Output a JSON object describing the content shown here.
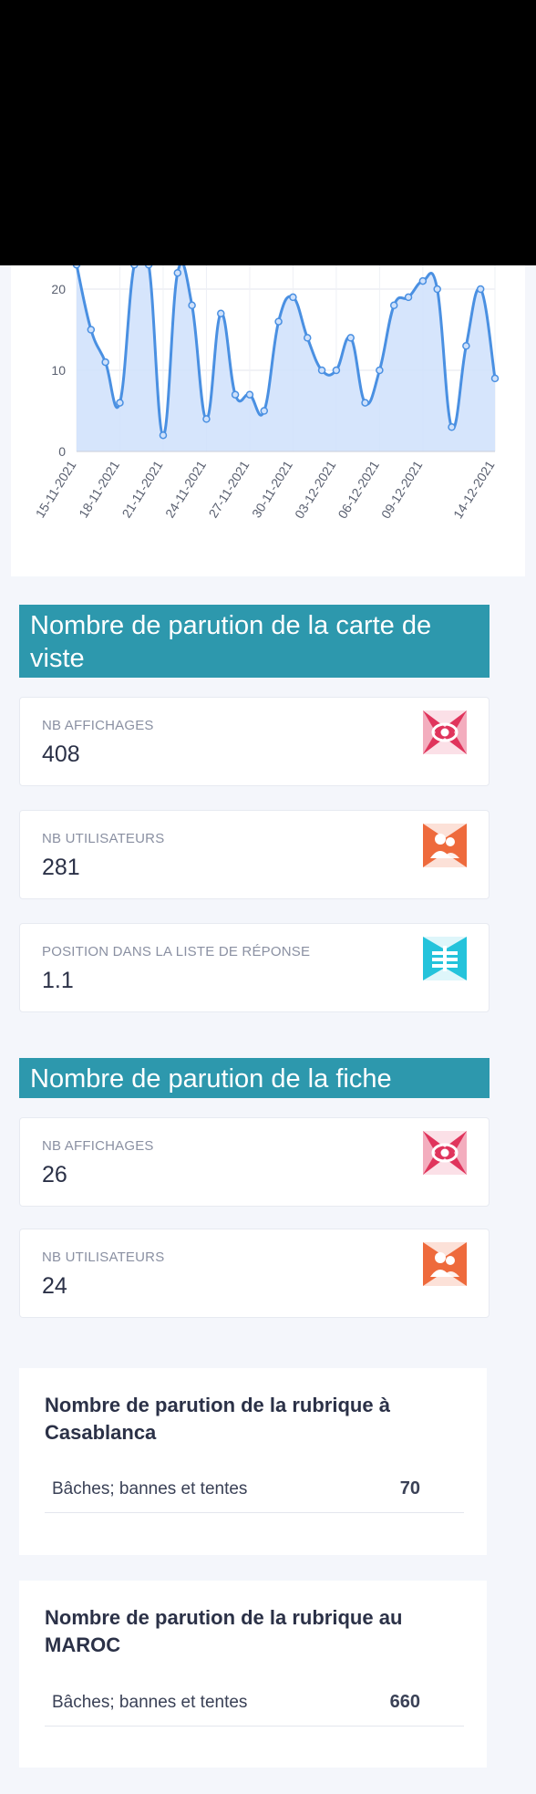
{
  "chart_data": {
    "type": "area",
    "x": [
      "15-11-2021",
      "16-11-2021",
      "17-11-2021",
      "18-11-2021",
      "19-11-2021",
      "20-11-2021",
      "21-11-2021",
      "22-11-2021",
      "23-11-2021",
      "24-11-2021",
      "25-11-2021",
      "26-11-2021",
      "27-11-2021",
      "28-11-2021",
      "29-11-2021",
      "30-11-2021",
      "01-12-2021",
      "02-12-2021",
      "03-12-2021",
      "04-12-2021",
      "05-12-2021",
      "06-12-2021",
      "07-12-2021",
      "08-12-2021",
      "09-12-2021",
      "10-12-2021",
      "11-12-2021",
      "12-12-2021",
      "13-12-2021",
      "14-12-2021"
    ],
    "x_tick_labels": [
      "15-11-2021",
      "18-11-2021",
      "21-11-2021",
      "24-11-2021",
      "27-11-2021",
      "30-11-2021",
      "03-12-2021",
      "06-12-2021",
      "09-12-2021",
      "14-12-2021"
    ],
    "values": [
      23,
      15,
      11,
      6,
      23,
      23,
      2,
      22,
      18,
      4,
      17,
      7,
      7,
      5,
      16,
      19,
      14,
      10,
      10,
      14,
      6,
      10,
      18,
      19,
      21,
      20,
      3,
      13,
      20,
      9
    ],
    "y_ticks": [
      0,
      10,
      20
    ],
    "ylim": [
      0,
      20
    ],
    "grid": true,
    "colors": {
      "line": "#4a90e2",
      "fill": "#cfe1fb",
      "point": "#4a90e2"
    }
  },
  "carte": {
    "title": "Nombre de parution de la carte de viste",
    "stats": [
      {
        "label": "NB AFFICHAGES",
        "value": "408",
        "icon": "eye-icon",
        "color": "#e0345c"
      },
      {
        "label": "NB UTILISATEURS",
        "value": "281",
        "icon": "users-icon",
        "color": "#ee6a3c"
      },
      {
        "label": "POSITION DANS LA LISTE DE RÉPONSE",
        "value": "1.1",
        "icon": "list-icon",
        "color": "#24c3db"
      }
    ]
  },
  "fiche": {
    "title": "Nombre de parution de la fiche",
    "stats": [
      {
        "label": "NB AFFICHAGES",
        "value": "26",
        "icon": "eye-icon",
        "color": "#e0345c"
      },
      {
        "label": "NB UTILISATEURS",
        "value": "24",
        "icon": "users-icon",
        "color": "#ee6a3c"
      }
    ]
  },
  "rubrique_casablanca": {
    "title": "Nombre de parution de la rubrique à Casablanca",
    "rows": [
      {
        "name": "Bâches; bannes et tentes",
        "count": "70"
      }
    ]
  },
  "rubrique_maroc": {
    "title": "Nombre de parution de la rubrique au MAROC",
    "rows": [
      {
        "name": "Bâches; bannes et tentes",
        "count": "660"
      }
    ]
  }
}
